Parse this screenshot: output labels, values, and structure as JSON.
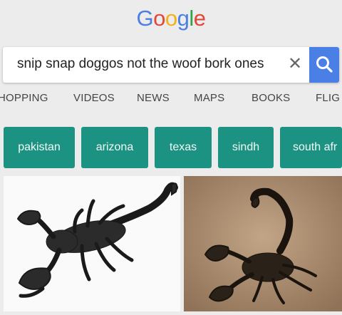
{
  "logo": {
    "letters": [
      {
        "char": "G",
        "color": "#4b7fe0"
      },
      {
        "char": "o",
        "color": "#e3463a"
      },
      {
        "char": "o",
        "color": "#f2b21a"
      },
      {
        "char": "g",
        "color": "#4b7fe0"
      },
      {
        "char": "l",
        "color": "#2fa24e"
      },
      {
        "char": "e",
        "color": "#e3463a"
      }
    ]
  },
  "search": {
    "query": "snip snap doggos not the woof bork ones",
    "clear_symbol": "✕",
    "button_icon": "search-icon"
  },
  "tabs": [
    {
      "label": "HOPPING"
    },
    {
      "label": "VIDEOS"
    },
    {
      "label": "NEWS"
    },
    {
      "label": "MAPS"
    },
    {
      "label": "BOOKS"
    },
    {
      "label": "FLIG"
    }
  ],
  "chips": [
    {
      "label": "pakistan"
    },
    {
      "label": "arizona"
    },
    {
      "label": "texas"
    },
    {
      "label": "sindh"
    },
    {
      "label": "south afr"
    }
  ],
  "images": [
    {
      "subject": "scorpion-icon",
      "background": "#fafafa"
    },
    {
      "subject": "scorpion-icon",
      "background": "#a88a6b"
    }
  ],
  "colors": {
    "accent_blue": "#4a7fe6",
    "chip_teal": "#1c9382"
  }
}
